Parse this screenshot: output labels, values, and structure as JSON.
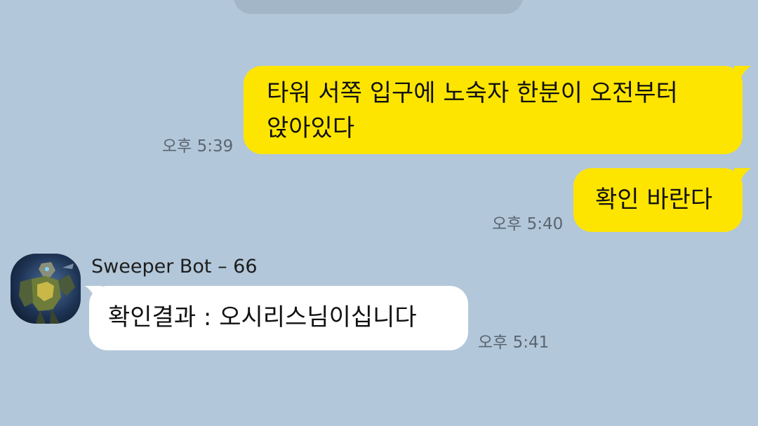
{
  "app": {
    "background": "#b2c7da",
    "my_bubble_color": "#fee500",
    "their_bubble_color": "#ffffff"
  },
  "messages": [
    {
      "direction": "outgoing",
      "lines": [
        "타워 서쪽 입구에 노숙자 한분이 오전부터",
        "앉아있다"
      ],
      "time": "오후 5:39"
    },
    {
      "direction": "outgoing",
      "lines": [
        "확인 바란다"
      ],
      "time": "오후 5:40"
    },
    {
      "direction": "incoming",
      "sender": "Sweeper Bot – 66",
      "avatar_icon": "robot-avatar-icon",
      "lines": [
        "확인결과 : 오시리스님이십니다"
      ],
      "time": "오후 5:41"
    }
  ]
}
